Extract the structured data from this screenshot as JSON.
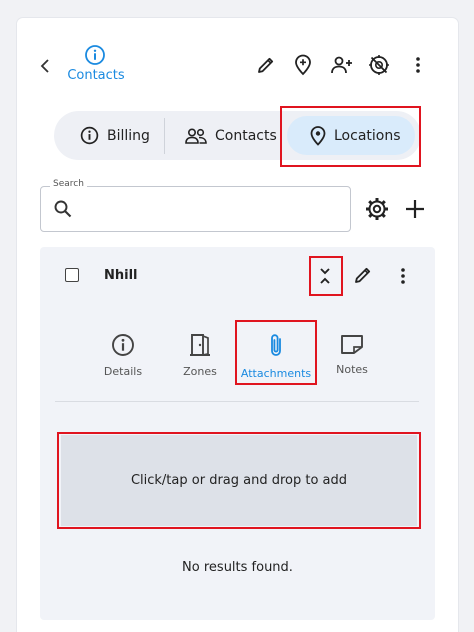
{
  "header": {
    "title": "Contacts",
    "tools": [
      "pencil-icon",
      "location-pin-plus-icon",
      "person-add-icon",
      "no-location-icon",
      "more-vertical-icon"
    ]
  },
  "segments": [
    {
      "label": "Billing",
      "icon": "info-icon",
      "active": false
    },
    {
      "label": "Contacts",
      "icon": "people-icon",
      "active": false
    },
    {
      "label": "Locations",
      "icon": "location-pin-icon",
      "active": true
    }
  ],
  "search": {
    "label": "Search",
    "value": ""
  },
  "item": {
    "name": "Nhill",
    "tabs": [
      {
        "label": "Details",
        "icon": "info-icon",
        "active": false
      },
      {
        "label": "Zones",
        "icon": "door-icon",
        "active": false
      },
      {
        "label": "Attachments",
        "icon": "paperclip-icon",
        "active": true
      },
      {
        "label": "Notes",
        "icon": "note-icon",
        "active": false
      }
    ],
    "dropzone_text": "Click/tap or drag and drop to add",
    "empty_text": "No results found."
  },
  "colors": {
    "accent": "#1a8ae0",
    "highlight": "#e0141f",
    "active_segment": "#d9ebfb",
    "dropzone": "#dde1e8"
  }
}
